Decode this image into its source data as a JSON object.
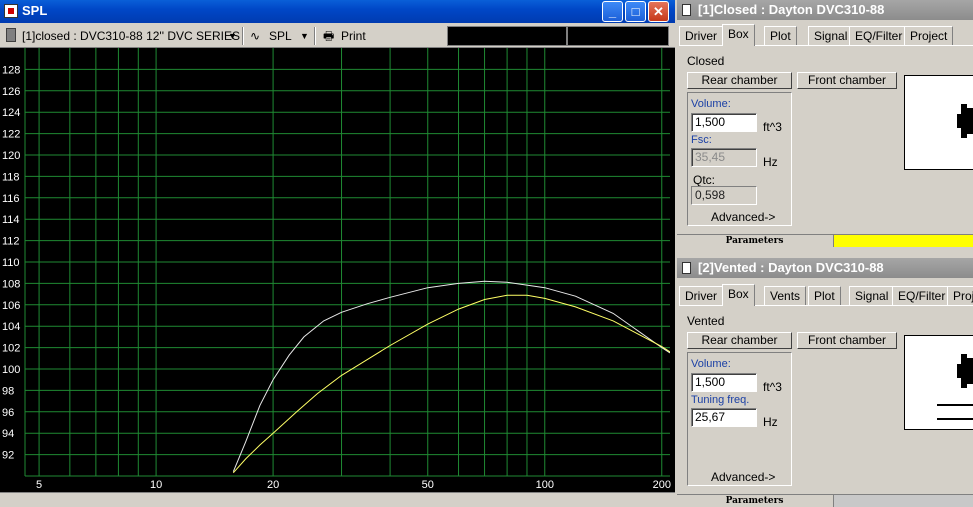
{
  "spl_window": {
    "title": "SPL",
    "buttons": {
      "minimize": "_",
      "maximize": "□",
      "close": "✕"
    },
    "toolbar": {
      "project_selector": "[1]closed : DVC310-88 12'' DVC SERIES",
      "view_selector": "SPL",
      "print_label": "Print"
    }
  },
  "chart_data": {
    "type": "line",
    "x_scale": "log",
    "xlim": [
      4.6,
      210
    ],
    "ylim": [
      90,
      130
    ],
    "x_ticks": [
      5,
      10,
      20,
      50,
      100,
      200
    ],
    "y_ticks": [
      92,
      94,
      96,
      98,
      100,
      102,
      104,
      106,
      108,
      110,
      112,
      114,
      116,
      118,
      120,
      122,
      124,
      126,
      128
    ],
    "grid": true,
    "background": "#000000",
    "grid_color": "#1f8a33",
    "series": [
      {
        "color": "#e8e8e8",
        "x": [
          15.8,
          17,
          18.5,
          20,
          22,
          24,
          27,
          30,
          35,
          40,
          50,
          60,
          70,
          80,
          100,
          120,
          150,
          200,
          210
        ],
        "y": [
          90.4,
          93.2,
          96.6,
          99.0,
          101.3,
          103.0,
          104.5,
          105.3,
          106.1,
          106.7,
          107.6,
          108.0,
          108.2,
          108.1,
          107.6,
          106.8,
          105.2,
          102.0,
          101.5
        ]
      },
      {
        "color": "#ffff66",
        "x": [
          15.8,
          17,
          18.5,
          20,
          23,
          26,
          30,
          35,
          40,
          50,
          60,
          70,
          80,
          90,
          100,
          120,
          150,
          200,
          210
        ],
        "y": [
          90.3,
          91.6,
          92.9,
          94.0,
          96.0,
          97.7,
          99.4,
          100.9,
          102.2,
          104.2,
          105.6,
          106.5,
          106.9,
          106.9,
          106.6,
          105.8,
          104.5,
          102.1,
          101.6
        ]
      }
    ]
  },
  "closed_panel": {
    "title": "[1]Closed : Dayton DVC310-88",
    "tabs": [
      "Driver",
      "Box",
      "Plot",
      "Signal",
      "EQ/Filter",
      "Project"
    ],
    "active_tab": "Box",
    "box_type": "Closed",
    "rear_chamber_label": "Rear chamber",
    "front_chamber_label": "Front chamber",
    "volume_label": "Volume:",
    "volume_value": "1,500",
    "volume_unit": "ft^3",
    "fsc_label": "Fsc:",
    "fsc_value": "35,45",
    "fsc_unit": "Hz",
    "qtc_label": "Qtc:",
    "qtc_value": "0,598",
    "advanced_label": "Advanced->",
    "parameters_label": "Parameters",
    "parameters_progress": 1.0,
    "parameters_color": "#ffff00"
  },
  "vented_panel": {
    "title": "[2]Vented : Dayton DVC310-88",
    "tabs": [
      "Driver",
      "Box",
      "Vents",
      "Plot",
      "Signal",
      "EQ/Filter",
      "Proje"
    ],
    "active_tab": "Box",
    "box_type": "Vented",
    "rear_chamber_label": "Rear chamber",
    "front_chamber_label": "Front chamber",
    "volume_label": "Volume:",
    "volume_value": "1,500",
    "volume_unit": "ft^3",
    "tuning_label": "Tuning freq.",
    "tuning_value": "25,67",
    "tuning_unit": "Hz",
    "advanced_label": "Advanced->",
    "parameters_label": "Parameters"
  }
}
